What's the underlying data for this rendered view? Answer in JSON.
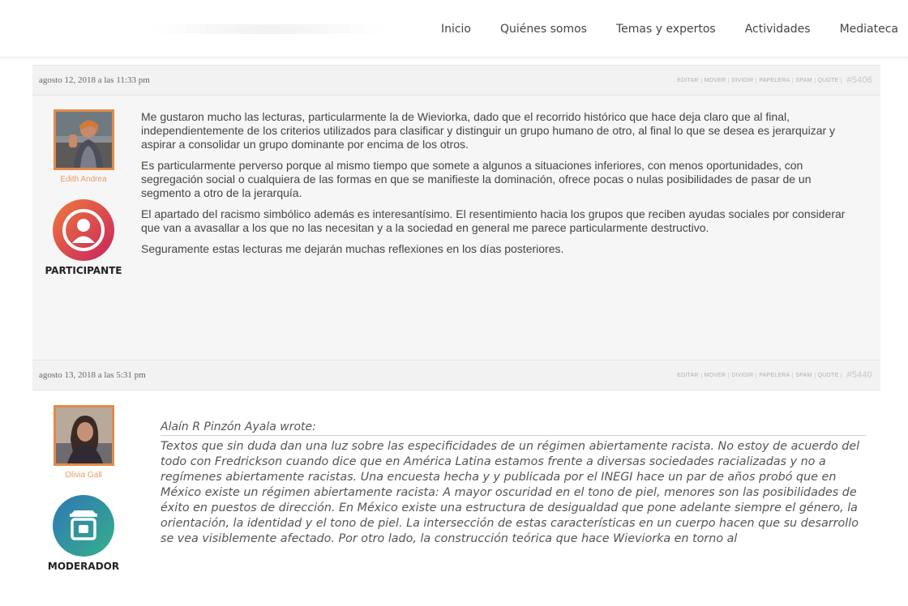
{
  "nav": {
    "items": [
      "Inicio",
      "Quiénes somos",
      "Temas y expertos",
      "Actividades",
      "Mediateca"
    ]
  },
  "posts": [
    {
      "date": "agosto 12, 2018 a las 11:33 pm",
      "actions": [
        "Editar",
        "Mover",
        "Dividir",
        "Papelera",
        "Spam",
        "Quote"
      ],
      "id": "#5406",
      "author": "Edith Andrea",
      "role": "PARTICIPANTE",
      "role_color": "#e0485a",
      "paragraphs": [
        "Me gustaron mucho las lecturas, particularmente la de Wieviorka, dado que el recorrido histórico que hace deja claro que al final, independientemente de los criterios utilizados para clasificar y distinguir un grupo humano de otro, al final lo que se desea es jerarquizar y aspirar a consolidar un grupo dominante por encima de los otros.",
        "Es particularmente perverso porque al mismo tiempo que somete a algunos a situaciones inferiores, con menos oportunidades, con segregación social o cualquiera de las formas en que se manifieste la dominación, ofrece pocas o nulas posibilidades de pasar de un segmento a otro de la jerarquía.",
        "El apartado del racismo simbólico además es interesantísimo. El resentimiento hacia los grupos que reciben ayudas sociales por considerar que van a avasallar a los que no las necesitan y a la sociedad en general me parece particularmente destructivo.",
        "Seguramente estas lecturas me dejarán muchas reflexiones en los días posteriores."
      ]
    },
    {
      "date": "agosto 13, 2018 a las 5:31 pm",
      "actions": [
        "Editar",
        "Mover",
        "Dividir",
        "Papelera",
        "Spam",
        "Quote"
      ],
      "id": "#5440",
      "author": "Olivia Gall",
      "role": "MODERADOR",
      "role_color": "#3a8f9b",
      "quote_author": "Alaín R Pinzón Ayala wrote:",
      "quote_text": "Textos que sin duda dan una luz sobre las especificidades de un régimen abiertamente racista. No estoy de acuerdo del todo con Fredrickson cuando dice que en América Latina estamos frente a diversas sociedades racializadas y no a regímenes abiertamente racistas. Una encuesta hecha y y publicada por el INEGI hace un par de años probó que en México existe un régimen abiertamente racista: A mayor oscuridad en el tono de piel, menores son las posibilidades de éxito en puestos de dirección. En México existe una estructura de desigualdad que pone adelante siempre el género, la orientación, la identidad y el tono de piel. La intersección de estas características en un cuerpo hacen que su desarrollo se vea visiblemente afectado. Por otro lado, la construcción teórica que hace Wieviorka en torno al"
    }
  ],
  "colors": {
    "author_name": "#e59b68",
    "avatar_border": "#e38a4a"
  },
  "icons": [
    "participant-user-icon",
    "moderator-icon"
  ]
}
